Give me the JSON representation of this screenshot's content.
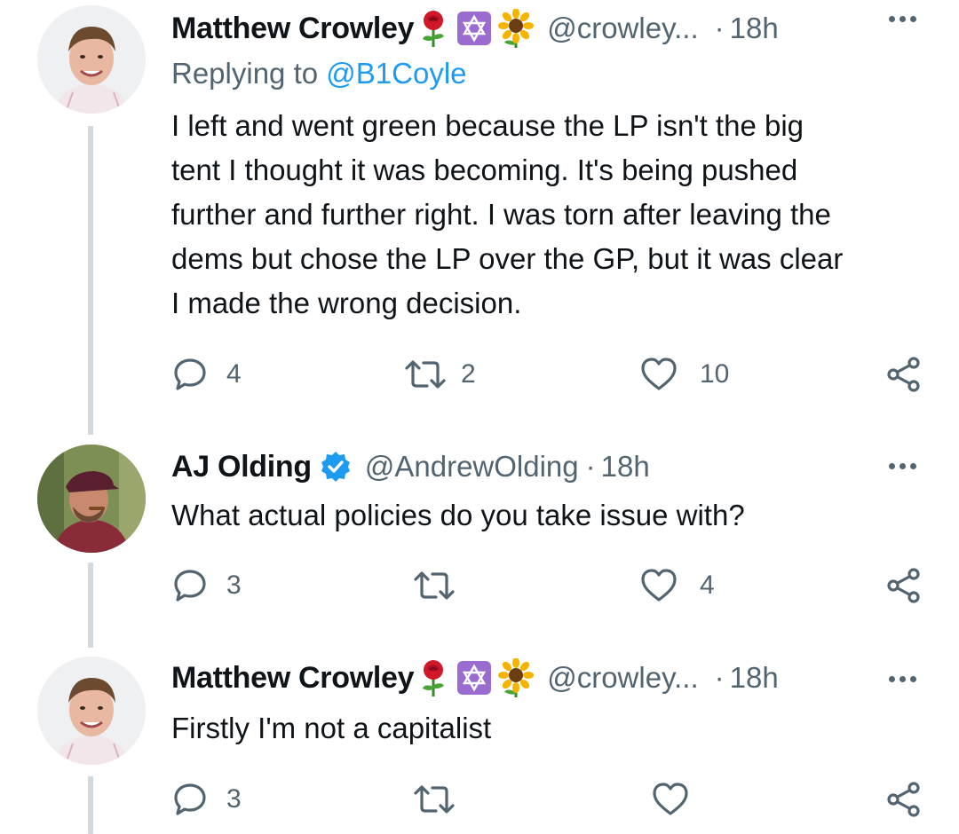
{
  "tweets": [
    {
      "name": "Matthew Crowley",
      "emojis": [
        "rose-icon",
        "star-of-david-icon",
        "sunflower-icon"
      ],
      "handle": "@crowley...",
      "time": "18h",
      "replying_prefix": "Replying to",
      "replying_to": "@B1Coyle",
      "lines": [
        "I left and went green because the LP isn't the big",
        "tent I thought it was becoming. It's being pushed",
        "further and further right. I was torn after leaving the",
        "dems but chose the LP over the GP, but it was clear",
        "I made the wrong decision."
      ],
      "replies": "4",
      "retweets": "2",
      "likes": "10"
    },
    {
      "name": "AJ Olding",
      "verified": true,
      "handle": "@AndrewOlding",
      "time": "18h",
      "lines": [
        "What actual policies do you take issue with?"
      ],
      "replies": "3",
      "retweets": "",
      "likes": "4"
    },
    {
      "name": "Matthew Crowley",
      "emojis": [
        "rose-icon",
        "star-of-david-icon",
        "sunflower-icon"
      ],
      "handle": "@crowley...",
      "time": "18h",
      "lines": [
        "Firstly I'm not a capitalist"
      ],
      "replies": "3",
      "retweets": "",
      "likes": ""
    }
  ],
  "separator": "·",
  "colors": {
    "text": "#0f1419",
    "secondary": "#536471",
    "link": "#1d9bf0",
    "thread_line": "#cfd9de",
    "verified": "#1d9bf0"
  }
}
